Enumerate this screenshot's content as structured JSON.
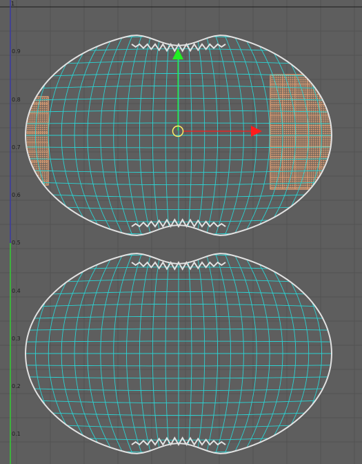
{
  "editor": "uv-editor",
  "axis": {
    "tick_labels": [
      "1",
      "0.9",
      "0.8",
      "0.7",
      "0.6",
      "0.5",
      "0.4",
      "0.3",
      "0.2",
      "0.1"
    ],
    "u_axis_color": "#3a3aa0",
    "v_axis_color": "#33cc33"
  },
  "colors": {
    "background": "#5e5e5e",
    "grid": "#525252",
    "wire": "#2bd3d3",
    "border": "#e2e2e2",
    "selection": "#f0a878",
    "gizmo_x": "#ff1c1c",
    "gizmo_y": "#22ee22",
    "gizmo_center": "#ffee66"
  },
  "selection": {
    "left_band": "selected-faces",
    "right_band": "selected-faces"
  },
  "gizmo": {
    "x_arrow": "move-x-arrow-icon",
    "y_arrow": "move-y-arrow-icon",
    "center": "pivot-circle-icon"
  }
}
